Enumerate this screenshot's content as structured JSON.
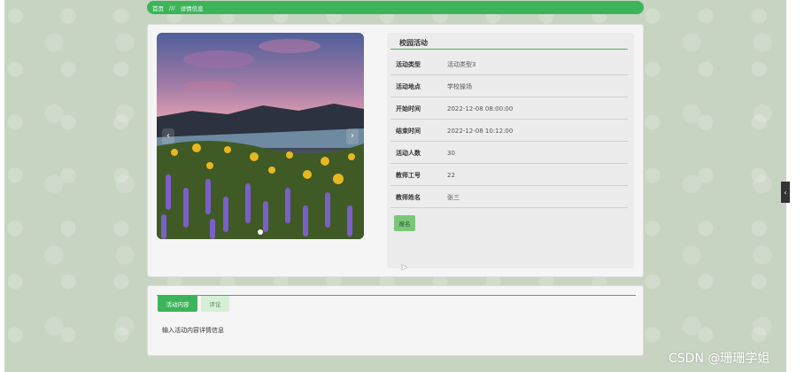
{
  "breadcrumb": {
    "home": "首页",
    "separator": "///",
    "current": "详情信息"
  },
  "detail": {
    "title": "校园活动",
    "fields": [
      {
        "label": "活动类型",
        "value": "活动类型3"
      },
      {
        "label": "活动地点",
        "value": "学校操场"
      },
      {
        "label": "开始时间",
        "value": "2022-12-08 08:00:00"
      },
      {
        "label": "结束时间",
        "value": "2022-12-08 10:12:00"
      },
      {
        "label": "活动人数",
        "value": "30"
      },
      {
        "label": "教师工号",
        "value": "22"
      },
      {
        "label": "教师姓名",
        "value": "张三"
      }
    ],
    "action_button": "报名"
  },
  "carousel": {
    "prev_icon": "‹",
    "next_icon": "›",
    "slide_count": 1
  },
  "tabs": [
    {
      "label": "活动内容",
      "active": true
    },
    {
      "label": "评论",
      "active": false
    }
  ],
  "tab_content": "输入活动内容详情信息",
  "side_toggle_icon": "‹",
  "watermark": "CSDN @珊珊学姐",
  "colors": {
    "accent": "#3cb55a",
    "button": "#7bc77a",
    "inactive_tab": "#d6efd6"
  }
}
